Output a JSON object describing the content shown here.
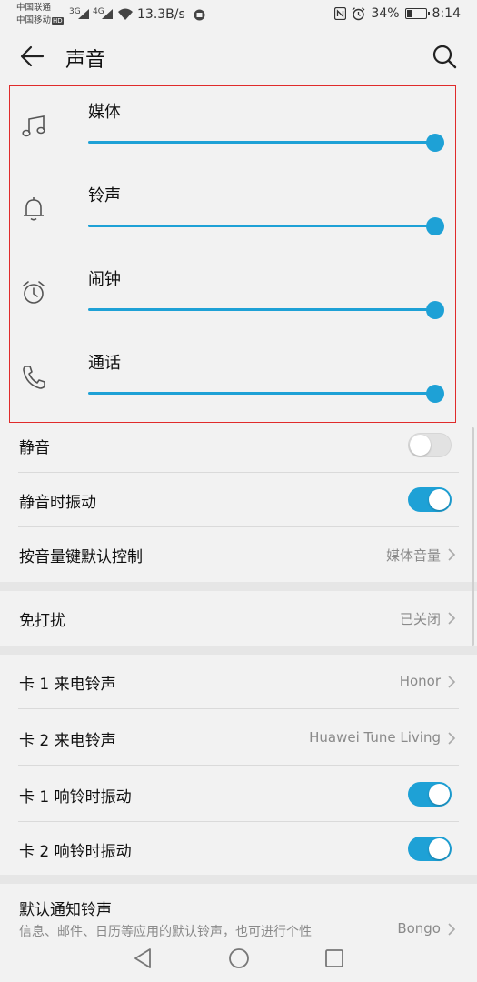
{
  "status_bar": {
    "carrier1": "中国联通",
    "carrier2": "中国移动",
    "hd_badge": "HD",
    "net1": "3G",
    "net2": "4G",
    "speed": "13.3B/s",
    "battery": "34%",
    "battery_fraction": 0.34,
    "time": "8:14"
  },
  "app_bar": {
    "title": "声音"
  },
  "volumes": [
    {
      "label": "媒体",
      "icon": "music-note-icon",
      "level": 1.0
    },
    {
      "label": "铃声",
      "icon": "bell-icon",
      "level": 1.0
    },
    {
      "label": "闹钟",
      "icon": "alarm-clock-icon",
      "level": 1.0
    },
    {
      "label": "通话",
      "icon": "phone-icon",
      "level": 1.0
    }
  ],
  "settings": {
    "silent": {
      "label": "静音",
      "on": false
    },
    "vibrate_silent": {
      "label": "静音时振动",
      "on": true
    },
    "volume_key": {
      "label": "按音量键默认控制",
      "value": "媒体音量"
    },
    "dnd": {
      "label": "免打扰",
      "value": "已关闭"
    },
    "sim1_ringtone": {
      "label": "卡 1 来电铃声",
      "value": "Honor"
    },
    "sim2_ringtone": {
      "label": "卡 2 来电铃声",
      "value": "Huawei Tune Living"
    },
    "sim1_vibrate": {
      "label": "卡 1 响铃时振动",
      "on": true
    },
    "sim2_vibrate": {
      "label": "卡 2 响铃时振动",
      "on": true
    },
    "notification_tone": {
      "label": "默认通知铃声",
      "sub": "信息、邮件、日历等应用的默认铃声，也可进行个性",
      "value": "Bongo"
    }
  },
  "colors": {
    "accent": "#1ea1d6",
    "highlight_border": "#e02b2b"
  }
}
